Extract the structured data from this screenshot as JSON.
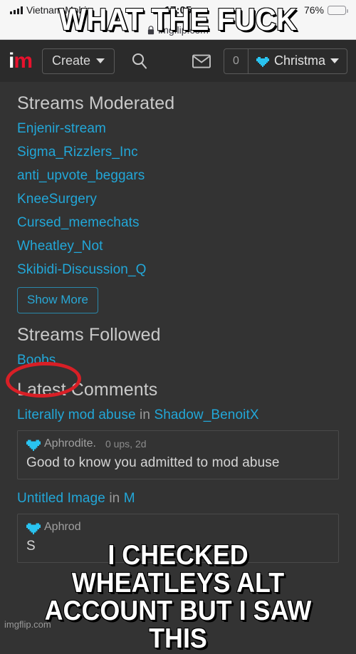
{
  "status_bar": {
    "carrier": "Vietnam Mobi",
    "time": "17:05",
    "battery_percent": "76%",
    "battery_level": 76,
    "signal_icon": "signal-bars-icon",
    "battery_icon": "battery-icon"
  },
  "browser": {
    "lock_icon": "lock-icon",
    "url": "imgflip.com"
  },
  "header": {
    "logo_i": "i",
    "logo_m": "m",
    "create_label": "Create",
    "search_icon": "search-icon",
    "mail_icon": "envelope-icon",
    "points": "0",
    "avatar_icon": "pixel-heart-avatar-icon",
    "username": "Christma",
    "dropdown_icon": "chevron-down-icon"
  },
  "streams_moderated": {
    "title": "Streams Moderated",
    "items": [
      "Enjenir-stream",
      "Sigma_Rizzlers_Inc",
      "anti_upvote_beggars",
      "KneeSurgery",
      "Cursed_memechats",
      "Wheatley_Not",
      "Skibidi-Discussion_Q"
    ],
    "show_more_label": "Show More"
  },
  "streams_followed": {
    "title": "Streams Followed",
    "items": [
      "Boobs"
    ]
  },
  "latest_comments": {
    "title": "Latest Comments",
    "in_label": "in",
    "comments": [
      {
        "post_title": "Literally mod abuse",
        "stream": "Shadow_BenoitX",
        "author": "Aphrodite.",
        "stats": "0 ups, 2d",
        "body": "Good to know you admitted to mod abuse",
        "avatar_icon": "pixel-heart-avatar-icon"
      },
      {
        "post_title": "Untitled Image",
        "stream": "M",
        "author": "Aphrod",
        "stats": "",
        "body": "S",
        "avatar_icon": "pixel-heart-avatar-icon"
      }
    ]
  },
  "meme": {
    "top_text": "WHAT THE FUCK",
    "bottom_lines": [
      "I CHECKED",
      "WHEATLEYS ALT",
      "ACCOUNT BUT I SAW THIS"
    ],
    "watermark": "imgflip.com"
  },
  "annotation": {
    "type": "red-ellipse",
    "target": "Boobs",
    "color": "#d81f26"
  },
  "colors": {
    "page_bg": "#333333",
    "header_bg": "#2b2b2b",
    "link": "#22a7d8",
    "accent_red": "#e8112d",
    "avatar_cyan": "#29c3f0",
    "battery_yellow": "#ffcc00"
  }
}
